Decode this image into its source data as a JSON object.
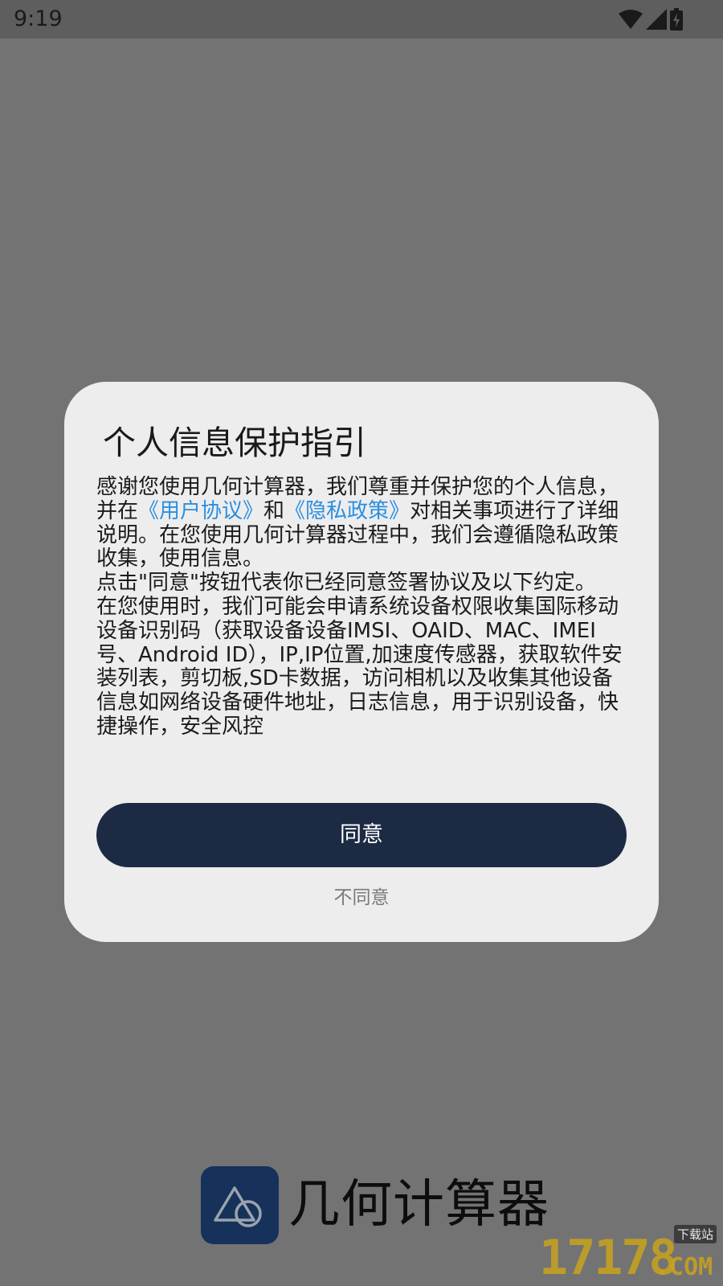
{
  "status_bar": {
    "time": "9:19",
    "icons": [
      "wifi-icon",
      "signal-icon",
      "battery-charging-icon"
    ]
  },
  "dialog": {
    "title": "个人信息保护指引",
    "body": {
      "p1_part1": "感谢您使用几何计算器，我们尊重并保护您的个人信息，并在",
      "user_agreement_link": "《用户协议》",
      "and": "和",
      "privacy_policy_link": "《隐私政策》",
      "p1_part2": "对相关事项进行了详细说明。在您使用几何计算器过程中，我们会遵循隐私政策收集，使用信息。",
      "p2": "点击\"同意\"按钮代表你已经同意签署协议及以下约定。",
      "p3": "在您使用时，我们可能会申请系统设备权限收集国际移动设备识别码（获取设备设备IMSI、OAID、MAC、IMEI号、Android ID），IP,IP位置,加速度传感器，获取软件安装列表，剪切板,SD卡数据，访问相机以及收集其他设备信息如网络设备硬件地址，日志信息，用于识别设备，快捷操作，安全风控"
    },
    "agree_label": "同意",
    "disagree_label": "不同意"
  },
  "brand": {
    "name": "几何计算器",
    "logo_icon": "triangle-circle-logo-icon"
  },
  "watermark": {
    "number": "17178",
    "domain": ".COM",
    "tag": "下载站"
  },
  "colors": {
    "overlay": "#737373",
    "dialog_bg": "#ededee",
    "button_bg": "#1c2a44",
    "link": "#2b8fe0",
    "logo_bg": "#16325a"
  }
}
